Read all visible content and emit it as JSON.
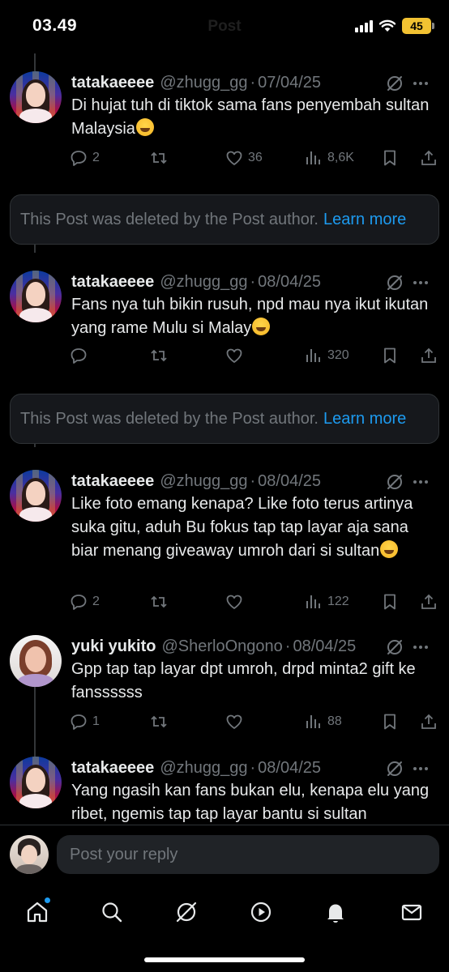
{
  "status_bar": {
    "time": "03.49",
    "battery": "45"
  },
  "header": {
    "title": "Post"
  },
  "posts": [
    {
      "name": "tatakaeeee",
      "handle": "@zhugg_gg",
      "date": "07/04/25",
      "text": "Di hujat tuh di tiktok sama fans penyembah sultan Malaysia",
      "replies": "2",
      "likes": "36",
      "views": "8,6K"
    },
    {
      "name": "tatakaeeee",
      "handle": "@zhugg_gg",
      "date": "08/04/25",
      "text": "Fans nya tuh bikin rusuh, npd mau nya ikut ikutan yang rame Mulu si Malay",
      "replies": "",
      "likes": "",
      "views": "320"
    },
    {
      "name": "tatakaeeee",
      "handle": "@zhugg_gg",
      "date": "08/04/25",
      "text": "Like foto emang kenapa? Like foto terus artinya suka gitu, aduh Bu fokus tap tap layar aja sana biar menang giveaway umroh dari si sultan",
      "replies": "2",
      "likes": "",
      "views": "122"
    },
    {
      "name": "yuki yukito",
      "handle": "@SherloOngono",
      "date": "08/04/25",
      "text": "Gpp tap tap layar dpt umroh, drpd minta2 gift ke fanssssss",
      "replies": "1",
      "likes": "",
      "views": "88"
    },
    {
      "name": "tatakaeeee",
      "handle": "@zhugg_gg",
      "date": "08/04/25",
      "text": "Yang ngasih kan fans bukan elu, kenapa elu yang ribet, ngemis tap tap layar bantu si sultan",
      "replies": "",
      "likes": "",
      "views": ""
    }
  ],
  "deleted_notice": {
    "text": "This Post was deleted by the Post author.",
    "link": "Learn more"
  },
  "reply_bar": {
    "placeholder": "Post your reply"
  },
  "tab_bar": {
    "items": [
      "home-icon",
      "search-icon",
      "grok-icon",
      "video-icon",
      "notifications-icon",
      "messages-icon"
    ]
  },
  "colors": {
    "accent": "#1d9bf0",
    "muted": "#71767b",
    "background": "#000000",
    "battery": "#f2c232"
  }
}
